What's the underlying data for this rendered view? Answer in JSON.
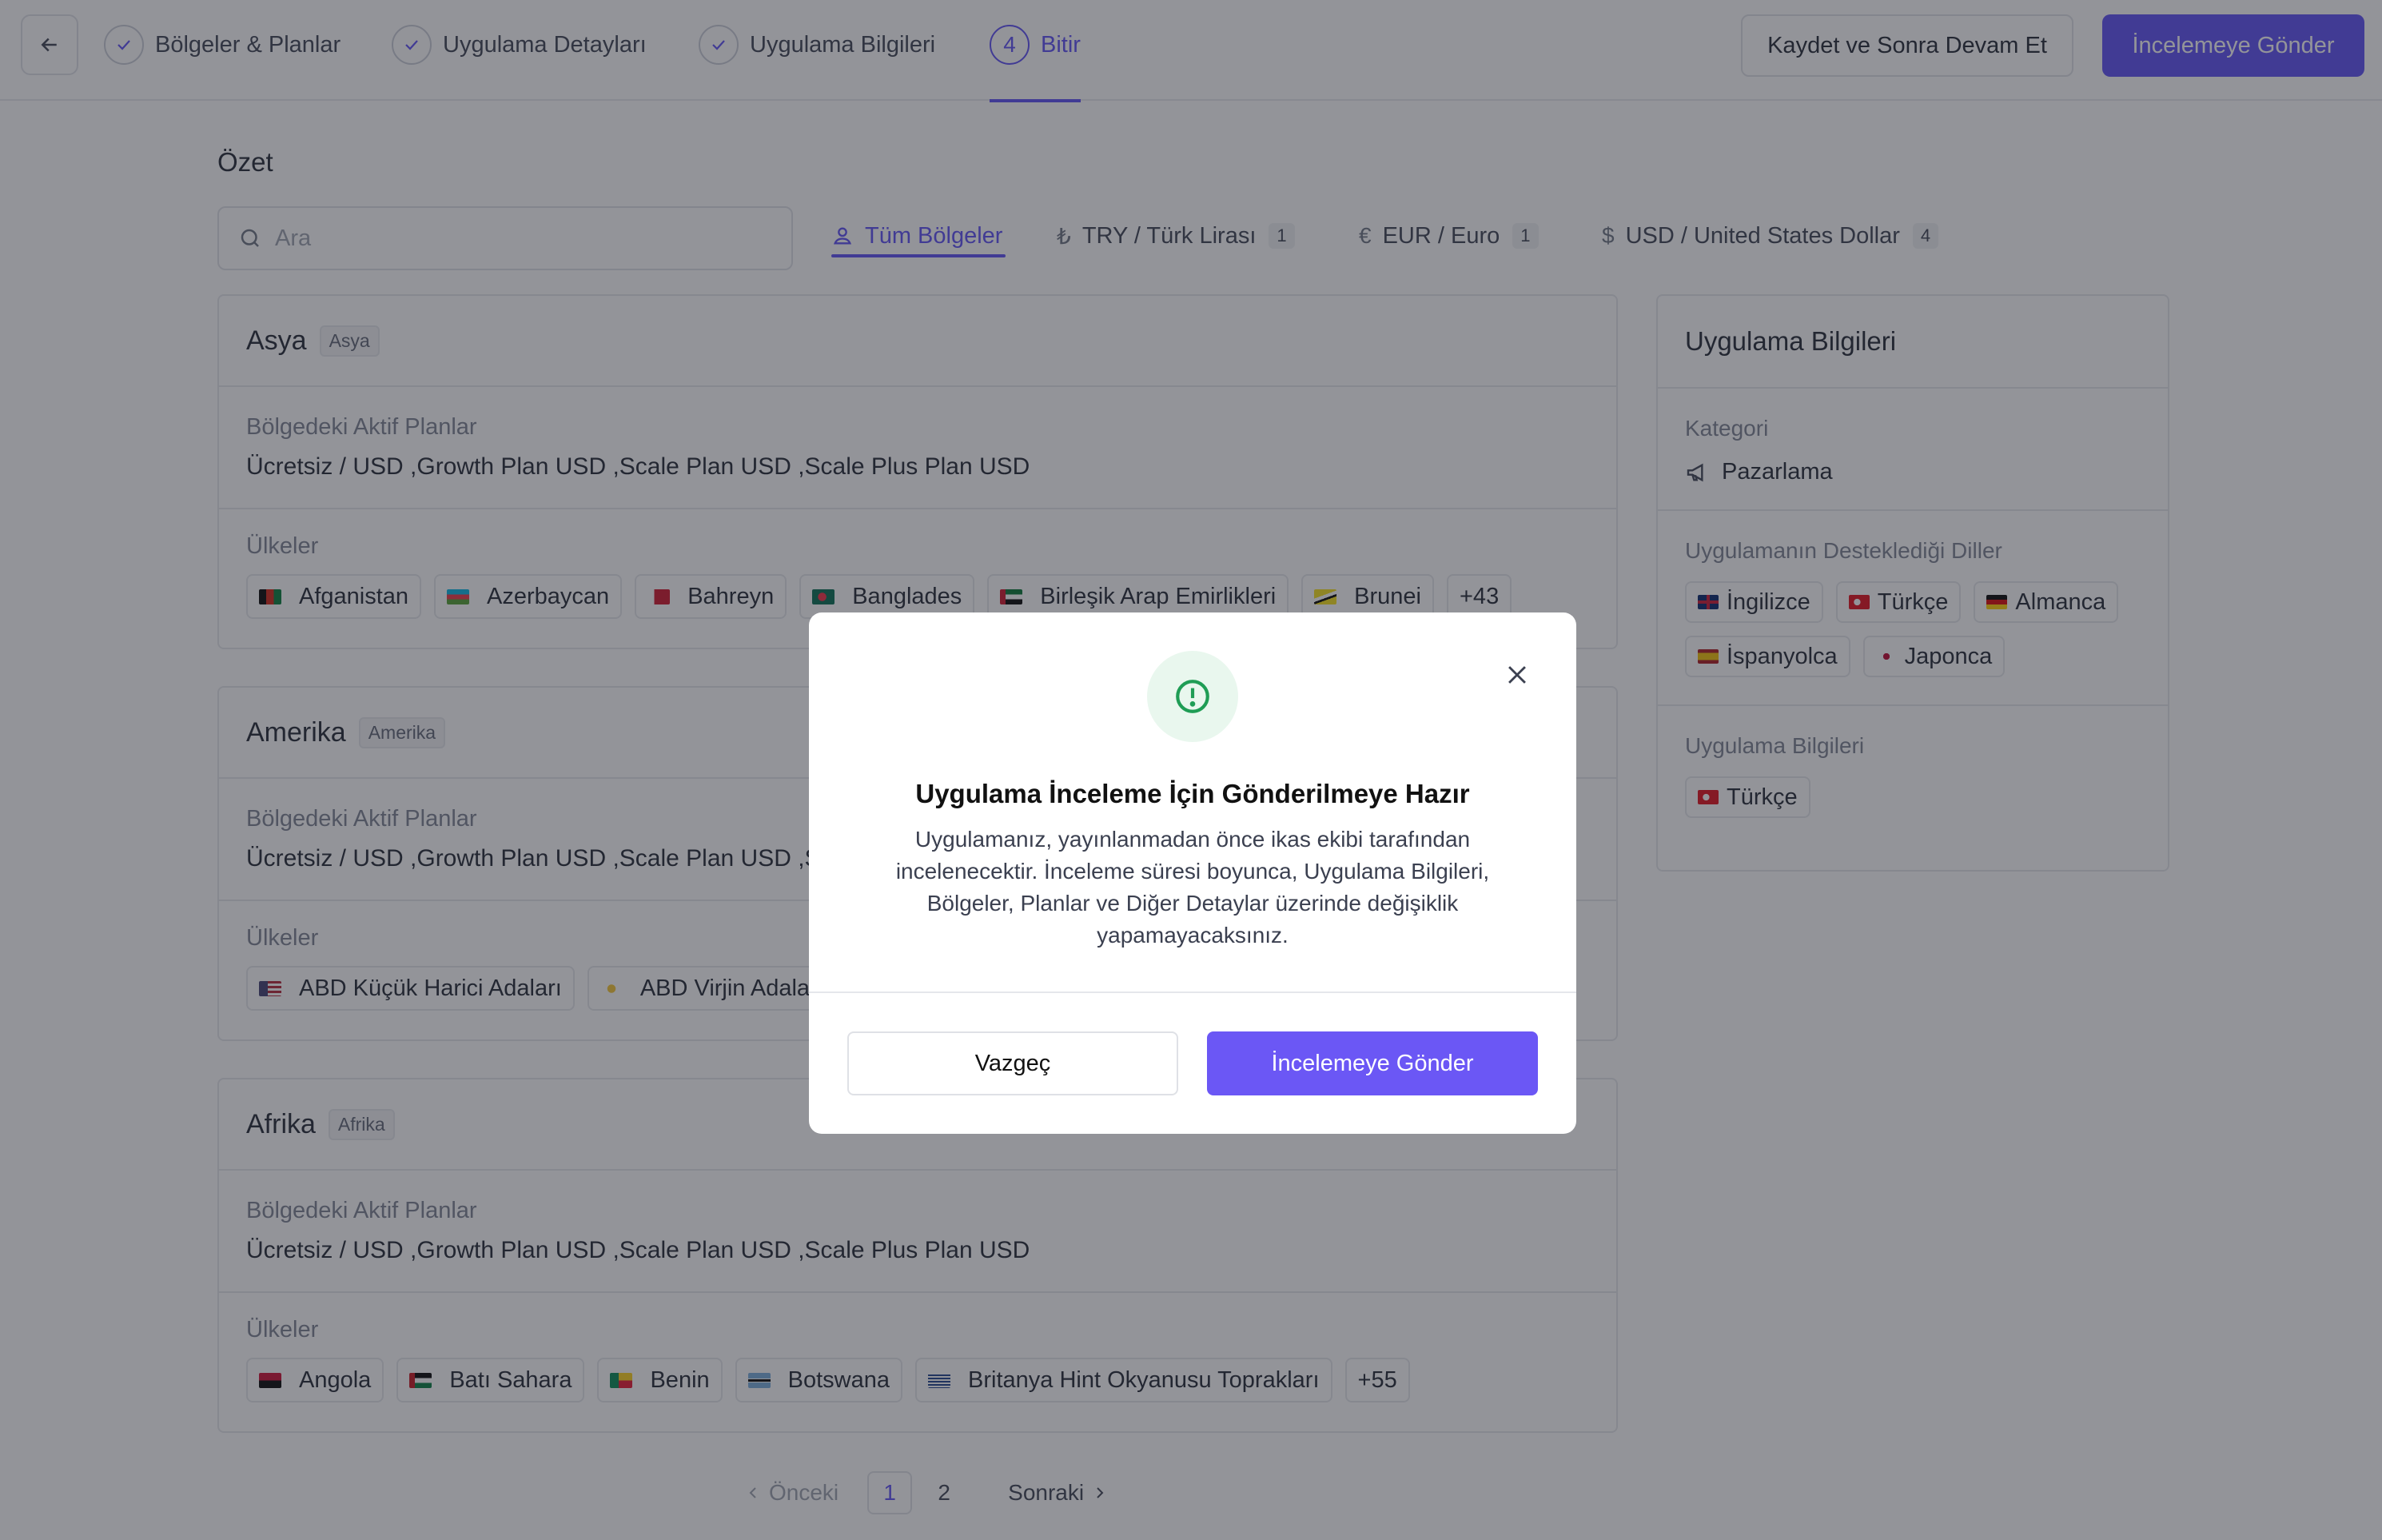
{
  "colors": {
    "accent": "#5b4cf5",
    "success": "#1f9d55"
  },
  "topbar": {
    "steps": [
      {
        "label": "Bölgeler & Planlar"
      },
      {
        "label": "Uygulama Detayları"
      },
      {
        "label": "Uygulama Bilgileri"
      },
      {
        "number": "4",
        "label": "Bitir"
      }
    ],
    "save_label": "Kaydet ve Sonra Devam Et",
    "submit_label": "İncelemeye Gönder"
  },
  "summary": {
    "title": "Özet",
    "search_placeholder": "Ara",
    "tabs": [
      {
        "label": "Tüm Bölgeler",
        "icon": "user-icon"
      },
      {
        "label": "TRY / Türk Lirası",
        "count": "1",
        "icon": "lira-icon"
      },
      {
        "label": "EUR / Euro",
        "count": "1",
        "icon": "euro-icon"
      },
      {
        "label": "USD / United States Dollar",
        "count": "4",
        "icon": "dollar-icon"
      }
    ]
  },
  "regions": [
    {
      "name": "Asya",
      "tag": "Asya",
      "plans_label": "Bölgedeki Aktif Planlar",
      "plans": "Ücretsiz / USD ,Growth Plan USD ,Scale Plan USD ,Scale Plus Plan USD",
      "countries_label": "Ülkeler",
      "countries": [
        "Afganistan",
        "Azerbaycan",
        "Bahreyn",
        "Banglades",
        "Birleşik Arap Emirlikleri",
        "Brunei"
      ],
      "more": "+43"
    },
    {
      "name": "Amerika",
      "tag": "Amerika",
      "plans_label": "Bölgedeki Aktif Planlar",
      "plans": "Ücretsiz / USD ,Growth Plan USD ,Scale Plan USD ,Scale Plus Plan USD",
      "countries_label": "Ülkeler",
      "countries": [
        "ABD Küçük Harici Adaları",
        "ABD Virjin Adaları"
      ]
    },
    {
      "name": "Afrika",
      "tag": "Afrika",
      "plans_label": "Bölgedeki Aktif Planlar",
      "plans": "Ücretsiz / USD ,Growth Plan USD ,Scale Plan USD ,Scale Plus Plan USD",
      "countries_label": "Ülkeler",
      "countries": [
        "Angola",
        "Batı Sahara",
        "Benin",
        "Botswana",
        "Britanya Hint Okyanusu Toprakları"
      ],
      "more": "+55"
    }
  ],
  "app_info": {
    "title": "Uygulama Bilgileri",
    "category_label": "Kategori",
    "category": "Pazarlama",
    "languages_label": "Uygulamanın Desteklediği Diller",
    "languages": [
      "İngilizce",
      "Türkçe",
      "Almanca",
      "İspanyolca",
      "Japonca"
    ],
    "info_label": "Uygulama Bilgileri",
    "info_languages": [
      "Türkçe"
    ]
  },
  "pagination": {
    "prev": "Önceki",
    "pages": [
      "1",
      "2"
    ],
    "current": "1",
    "next": "Sonraki"
  },
  "modal": {
    "title": "Uygulama İnceleme İçin Gönderilmeye Hazır",
    "description": "Uygulamanız, yayınlanmadan önce ikas ekibi tarafından incelenecektir. İnceleme süresi boyunca, Uygulama Bilgileri, Bölgeler, Planlar ve Diğer Detaylar üzerinde değişiklik yapamayacaksınız.",
    "cancel_label": "Vazgeç",
    "submit_label": "İncelemeye Gönder"
  }
}
